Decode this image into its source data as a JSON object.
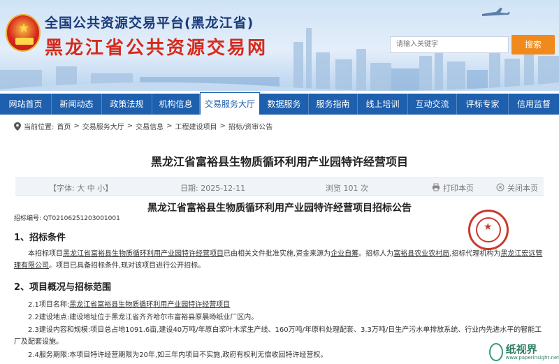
{
  "header": {
    "title_line1": "全国公共资源交易平台(黑龙江省)",
    "title_line2": "黑龙江省公共资源交易网",
    "search_placeholder": "请输入关键字",
    "search_button": "搜索"
  },
  "nav": {
    "items": [
      "网站首页",
      "新闻动态",
      "政策法规",
      "机构信息",
      "交易服务大厅",
      "数据服务",
      "服务指南",
      "线上培训",
      "互动交流",
      "评标专家",
      "信用监督"
    ],
    "active_index": 4
  },
  "breadcrumb": {
    "prefix": "当前位置:",
    "items": [
      "首页",
      "交易服务大厅",
      "交易信息",
      "工程建设项目",
      "招标/资审公告"
    ],
    "separator": ">"
  },
  "page_title": "黑龙江省富裕县生物质循环利用产业园特许经营项目",
  "meta": {
    "font_size_label": "【字体: 大 中 小】",
    "date": "日期: 2025-12-11",
    "views": "浏览 101 次",
    "print": "打印本页",
    "close": "关闭本页"
  },
  "announcement": {
    "title": "黑龙江省富裕县生物质循环利用产业园特许经营项目招标公告",
    "code": "招标编号: QT02106251203001001",
    "section1_heading": "1、招标条件",
    "section1_p1_a": "本招标项目",
    "section1_p1_project": "黑龙江省富裕县生物质循环利用产业园特许经营项目",
    "section1_p1_b": "已由相关文件批准实施,资金来源为",
    "section1_p1_fund": "企业自筹",
    "section1_p1_c": "。招标人为",
    "section1_p1_owner": "富裕县农业农村局",
    "section1_p1_d": ",招标代理机构为",
    "section1_p1_agent": "黑龙江宏远管理有限公司",
    "section1_p1_e": "。项目已具备招标条件,现对该项目进行公开招标。",
    "section2_heading": "2、项目概况与招标范围",
    "item1_a": "2.1项目名称:",
    "item1_name": "黑龙江省富裕县生物质循环利用产业园特许经营项目",
    "item2": "2.2建设地点:建设地址位于黑龙江省齐齐哈尔市富裕县原晨旸纸业厂区内。",
    "item3": "2.3建设内容和规模:项目总占地1091.6亩,建设40万吨/年原白浆叶木浆生产线、160万吨/年原料处理配套、3.3万吨/日生产污水单排放系统、行业内先进水平的智能工厂及配套设施。",
    "item4": "2.4服务期限:本项目特许经营期限为20年,如三年内项目不实施,政府有权利无偿收回特许经营权。"
  },
  "watermark": {
    "brand_cn": "纸视界",
    "brand_url": "www.paperinsight.net"
  },
  "colors": {
    "nav_bg": "#1e5fae",
    "title_red": "#d62a1c",
    "title_blue": "#1a3b7a",
    "search_orange": "#f08a1c",
    "seal_red": "#c9392c"
  }
}
